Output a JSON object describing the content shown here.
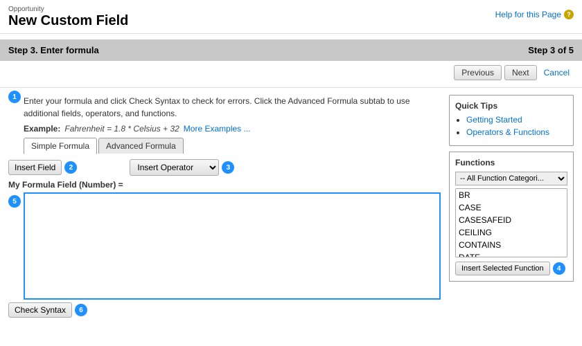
{
  "header": {
    "opportunity_label": "Opportunity",
    "page_title": "New Custom Field",
    "help_text": "Help for this Page"
  },
  "step_header": {
    "step_title": "Step 3. Enter formula",
    "step_count": "Step 3 of 5"
  },
  "nav": {
    "previous_label": "Previous",
    "next_label": "Next",
    "cancel_label": "Cancel"
  },
  "intro": {
    "text": "Enter your formula and click Check Syntax to check for errors. Click the Advanced Formula subtab to use additional fields, operators, and functions."
  },
  "example": {
    "label": "Example:",
    "value": "Fahrenheit = 1.8 * Celsius + 32",
    "more_link": "More Examples ..."
  },
  "tabs": [
    {
      "label": "Simple Formula",
      "active": true
    },
    {
      "label": "Advanced Formula",
      "active": false
    }
  ],
  "insert_field": {
    "label": "Insert Field"
  },
  "insert_operator": {
    "label": "Insert Operator",
    "options": [
      "Insert Operator",
      "+",
      "-",
      "*",
      "/",
      "=",
      "!=",
      "<",
      ">",
      "<=",
      ">=",
      "&&",
      "||",
      "!"
    ]
  },
  "formula_field": {
    "label": "My Formula Field (Number) =",
    "placeholder": ""
  },
  "check_syntax": {
    "label": "Check Syntax"
  },
  "quick_tips": {
    "title": "Quick Tips",
    "links": [
      {
        "label": "Getting Started"
      },
      {
        "label": "Operators & Functions"
      }
    ]
  },
  "functions": {
    "title": "Functions",
    "dropdown_default": "-- All Function Categori...",
    "list_items": [
      "BR",
      "CASE",
      "CASESAFEID",
      "CEILING",
      "CONTAINS",
      "DATE"
    ],
    "insert_button_label": "Insert Selected Function"
  },
  "badges": {
    "b1": "1",
    "b2": "2",
    "b3": "3",
    "b4": "4",
    "b5": "5",
    "b6": "6"
  }
}
